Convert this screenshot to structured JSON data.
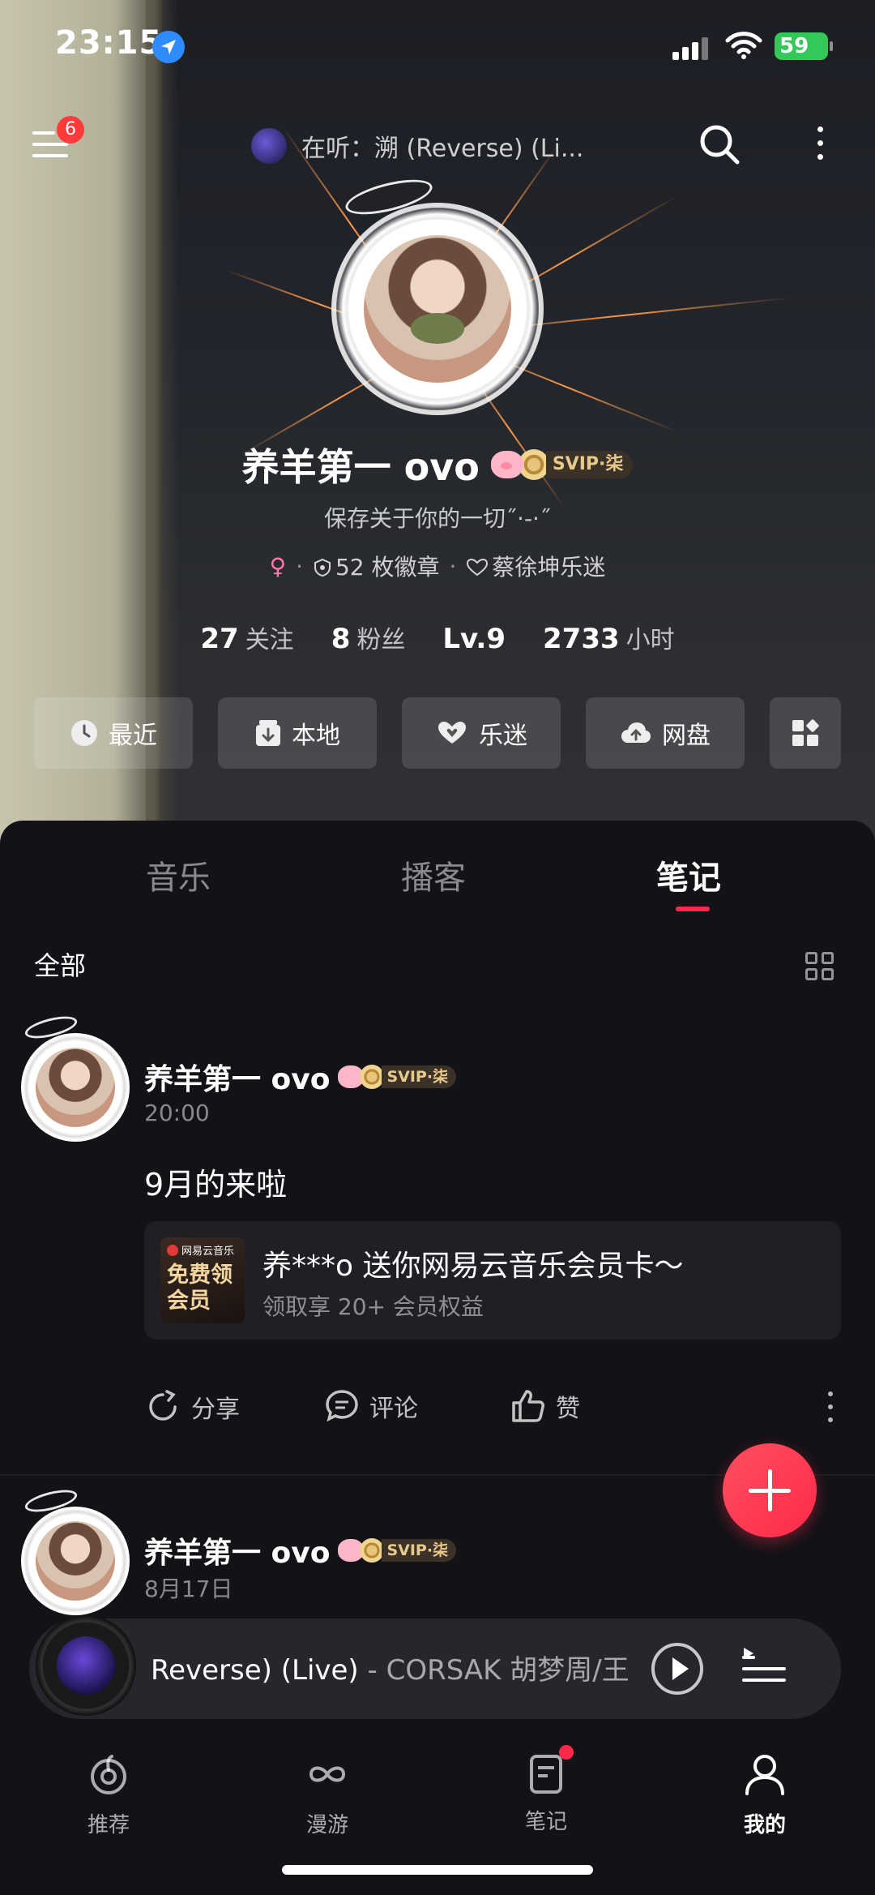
{
  "status": {
    "time": "23:15",
    "battery": "59"
  },
  "topbar": {
    "menu_badge": "6",
    "now_playing": "在听：溯 (Reverse) (Li..."
  },
  "profile": {
    "name": "养羊第一 ovo",
    "vip_label": "SVIP·柒",
    "signature": "保存关于你的一切˝·-·˝",
    "gender_icon": "female-icon",
    "badges": "52 枚徽章",
    "fan_of": "蔡徐坤乐迷",
    "stats": [
      {
        "value": "27",
        "label": "关注"
      },
      {
        "value": "8",
        "label": "粉丝"
      },
      {
        "value": "Lv.9",
        "label": ""
      },
      {
        "value": "2733",
        "label": "小时"
      }
    ]
  },
  "shortcuts": [
    {
      "label": "最近",
      "icon": "clock-icon"
    },
    {
      "label": "本地",
      "icon": "download-icon"
    },
    {
      "label": "乐迷",
      "icon": "heart-hands-icon"
    },
    {
      "label": "网盘",
      "icon": "cloud-upload-icon"
    },
    {
      "label": "",
      "icon": "grid-apps-icon"
    }
  ],
  "tabs": [
    "音乐",
    "播客",
    "笔记"
  ],
  "active_tab": "笔记",
  "filter": {
    "label": "全部"
  },
  "posts": [
    {
      "author": "养羊第一 ovo",
      "vip_label": "SVIP·柒",
      "time": "20:00",
      "text": "9月的来啦",
      "card": {
        "brand": "网易云音乐",
        "thumb_text": "免费领会员",
        "title": "养***o 送你网易云音乐会员卡～",
        "subtitle": "领取享 20+ 会员权益"
      },
      "actions": {
        "share": "分享",
        "comment": "评论",
        "like": "赞"
      }
    },
    {
      "author": "养羊第一 ovo",
      "vip_label": "SVIP·柒",
      "time": "8月17日"
    }
  ],
  "player": {
    "title": "Reverse) (Live)",
    "artist": " - CORSAK 胡梦周/王"
  },
  "bottom_nav": [
    {
      "label": "推荐",
      "icon": "netease-music-icon"
    },
    {
      "label": "漫游",
      "icon": "infinity-icon"
    },
    {
      "label": "笔记",
      "icon": "note-icon"
    },
    {
      "label": "我的",
      "icon": "person-icon"
    }
  ],
  "colors": {
    "accent": "#ff2a4a",
    "background": "#121217",
    "vip_gold": "#e8c98b",
    "battery": "#34c759"
  }
}
